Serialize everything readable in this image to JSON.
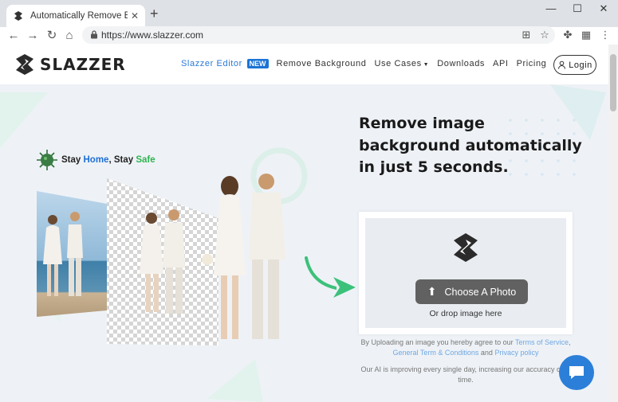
{
  "browser": {
    "tab_title": "Automatically Remove Backgro",
    "url": "https://www.slazzer.com",
    "new_tab_label": "+",
    "controls": {
      "minimize": "—",
      "maximize": "☐",
      "close": "✕"
    }
  },
  "nav": {
    "logo_text": "SLAZZER",
    "links": {
      "editor": "Slazzer Editor",
      "editor_badge": "NEW",
      "remove_bg": "Remove Background",
      "use_cases": "Use Cases",
      "downloads": "Downloads",
      "api": "API",
      "pricing": "Pricing"
    },
    "login": "Login"
  },
  "hero": {
    "stay_1": "Stay ",
    "stay_home": "Home",
    "stay_2": ", Stay ",
    "stay_safe": "Safe",
    "headline": "Remove image background automatically in just 5 seconds."
  },
  "upload": {
    "button": "Choose A Photo",
    "drop_text": "Or drop image here"
  },
  "terms": {
    "prefix": "By Uploading an image you hereby agree to our ",
    "tos": "Terms of Service",
    "comma": ",",
    "general": "General Term & Conditions",
    "and": " and ",
    "privacy": "Privacy policy"
  },
  "ai_note": "Our AI is improving every single day, increasing our accuracy over time.",
  "icons": {
    "tab_favicon": "slazzer-logo-icon",
    "chat": "chat-bubble-icon"
  },
  "colors": {
    "brand_blue": "#1b73d6",
    "accent_green": "#3cc17a",
    "page_bg": "#eef2f6",
    "button_gray": "#616161"
  }
}
